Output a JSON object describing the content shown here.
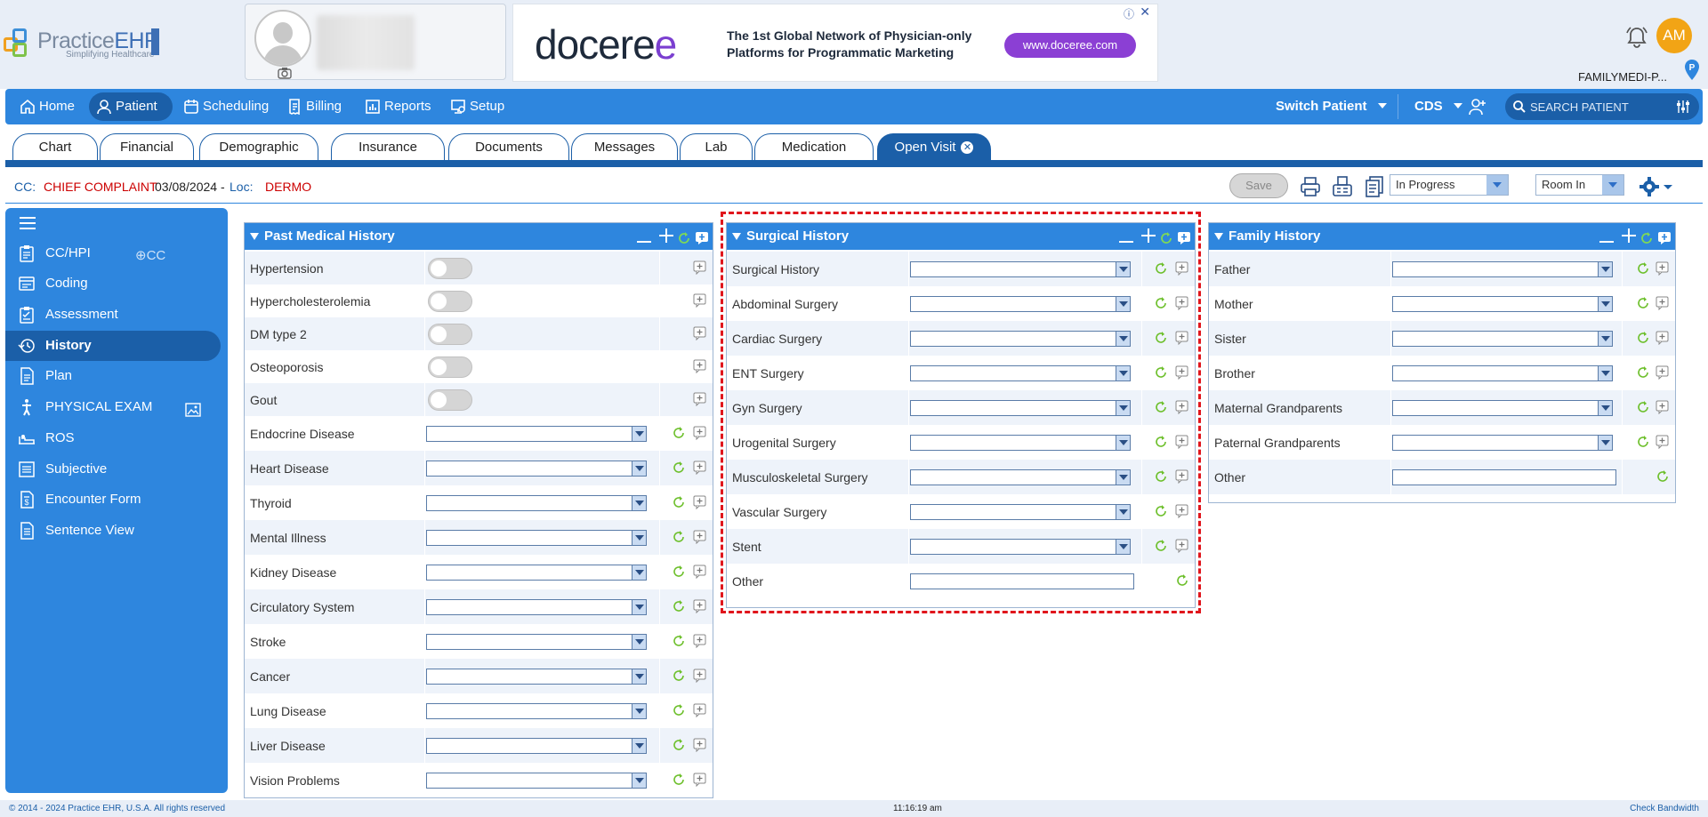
{
  "app": {
    "logo_name_a": "Practice",
    "logo_name_b": "EHR",
    "logo_tagline": "Simplifying Healthcare"
  },
  "ad": {
    "brand_a": "docere",
    "brand_b": "e",
    "copy": "The 1st Global Network of Physician-only Platforms for Programmatic Marketing",
    "cta": "www.doceree.com"
  },
  "user": {
    "initials": "AM",
    "practice": "FAMILYMEDI-P..."
  },
  "nav": {
    "items": [
      {
        "label": "Home",
        "icon": "home-icon"
      },
      {
        "label": "Patient",
        "icon": "user-icon"
      },
      {
        "label": "Scheduling",
        "icon": "calendar-icon"
      },
      {
        "label": "Billing",
        "icon": "billing-icon"
      },
      {
        "label": "Reports",
        "icon": "chart-icon"
      },
      {
        "label": "Setup",
        "icon": "setup-icon"
      }
    ],
    "switch_patient": "Switch Patient",
    "cds": "CDS",
    "search_placeholder": "SEARCH PATIENT"
  },
  "tabs": [
    "Chart",
    "Financial",
    "Demographic",
    "Insurance",
    "Documents",
    "Messages",
    "Lab",
    "Medication",
    "Open Visit"
  ],
  "visit": {
    "cc_label": "CC:",
    "cc_value": "CHIEF COMPLAINT",
    "date": "03/08/2024 -",
    "loc_label": "Loc:",
    "loc_value": "DERMO",
    "save": "Save",
    "status": "In Progress",
    "room": "Room In"
  },
  "sidebar": {
    "add_cc": "CC",
    "items": [
      {
        "label": "CC/HPI",
        "icon": "clipboard-icon"
      },
      {
        "label": "Coding",
        "icon": "coding-icon"
      },
      {
        "label": "Assessment",
        "icon": "assessment-icon"
      },
      {
        "label": "History",
        "icon": "history-icon"
      },
      {
        "label": "Plan",
        "icon": "plan-icon"
      },
      {
        "label": "PHYSICAL EXAM",
        "icon": "body-icon"
      },
      {
        "label": "ROS",
        "icon": "ros-icon"
      },
      {
        "label": "Subjective",
        "icon": "subjective-icon"
      },
      {
        "label": "Encounter Form",
        "icon": "encounter-icon"
      },
      {
        "label": "Sentence View",
        "icon": "document-icon"
      }
    ]
  },
  "past_medical": {
    "title": "Past Medical History",
    "toggle_rows": [
      "Hypertension",
      "Hypercholesterolemia",
      "DM type 2",
      "Osteoporosis",
      "Gout"
    ],
    "dropdown_rows": [
      "Endocrine Disease",
      "Heart Disease",
      "Thyroid",
      "Mental Illness",
      "Kidney Disease",
      "Circulatory System",
      "Stroke",
      "Cancer",
      "Lung Disease",
      "Liver Disease",
      "Vision Problems"
    ]
  },
  "surgical": {
    "title": "Surgical History",
    "dropdown_rows": [
      "Surgical History",
      "Abdominal Surgery",
      "Cardiac Surgery",
      "ENT Surgery",
      "Gyn Surgery",
      "Urogenital Surgery",
      "Musculoskeletal Surgery",
      "Vascular Surgery",
      "Stent"
    ],
    "text_row": "Other"
  },
  "family": {
    "title": "Family History",
    "dropdown_rows": [
      "Father",
      "Mother",
      "Sister",
      "Brother",
      "Maternal Grandparents",
      "Paternal Grandparents"
    ],
    "text_row": "Other"
  },
  "footer": {
    "copyright": "© 2014 - 2024 Practice EHR, U.S.A. All rights reserved",
    "time": "11:16:19 am",
    "bandwidth": "Check Bandwidth"
  },
  "colors": {
    "primary": "#2e86de",
    "primary_dark": "#1b5fa8",
    "alert_red": "#c00000",
    "refresh_green": "#6cbf2a"
  }
}
